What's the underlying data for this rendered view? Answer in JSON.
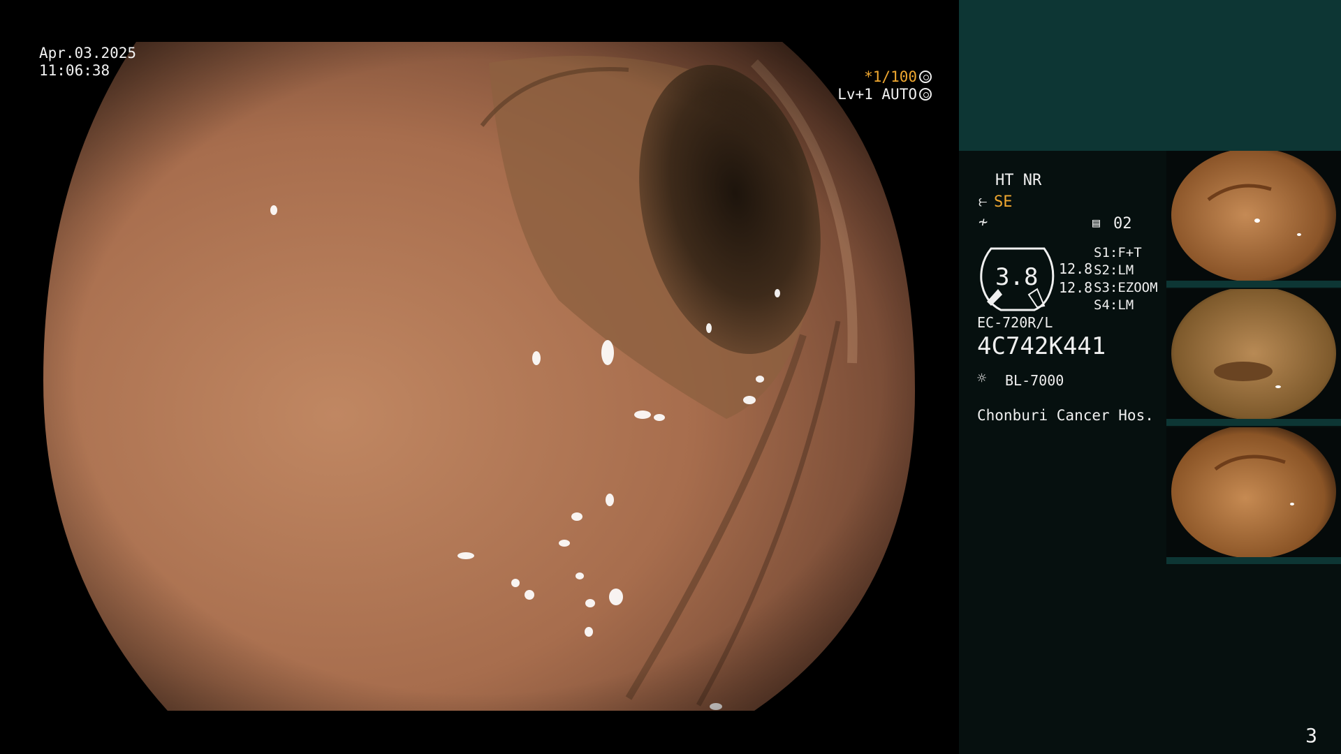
{
  "overlay": {
    "date": "Apr.03.2025",
    "time": "11:06:38",
    "shutter": "*1/100",
    "enhance": "Lv+1 AUTO"
  },
  "info": {
    "ht_nr": "HT NR",
    "se": "SE",
    "record_num": "02",
    "gauge_value": "3.8",
    "val_1": "12.8",
    "val_2": "12.8",
    "s1": "S1:F+T",
    "s2": "S2:LM",
    "s3": "S3:EZOOM",
    "s4": "S4:LM",
    "model": "EC-720R/L",
    "serial": "4C742K441",
    "light_source": "BL-7000",
    "hospital": "Chonburi Cancer Hos."
  },
  "thumbnails_count": 3,
  "page_number": "3",
  "colors": {
    "accent": "#f0a830",
    "panel_top": "#0d3634",
    "panel_bg": "#06100f"
  }
}
